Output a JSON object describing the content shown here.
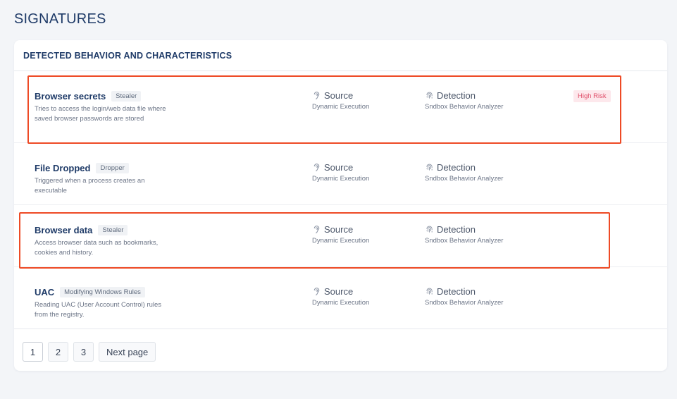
{
  "page": {
    "title": "SIGNATURES"
  },
  "card": {
    "header": "DETECTED BEHAVIOR AND CHARACTERISTICS"
  },
  "rows": [
    {
      "title": "Browser secrets",
      "tag": "Stealer",
      "description": "Tries to access the login/web data file where saved browser passwords are stored",
      "source_label": "Source",
      "source_value": "Dynamic Execution",
      "detection_label": "Detection",
      "detection_value": "Sndbox Behavior Analyzer",
      "risk": "High Risk"
    },
    {
      "title": "File Dropped",
      "tag": "Dropper",
      "description": "Triggered when a process creates an executable",
      "source_label": "Source",
      "source_value": "Dynamic Execution",
      "detection_label": "Detection",
      "detection_value": "Sndbox Behavior Analyzer"
    },
    {
      "title": "Browser data",
      "tag": "Stealer",
      "description": "Access browser data such as bookmarks, cookies and history.",
      "source_label": "Source",
      "source_value": "Dynamic Execution",
      "detection_label": "Detection",
      "detection_value": "Sndbox Behavior Analyzer"
    },
    {
      "title": "UAC",
      "tag": "Modifying Windows Rules",
      "description": "Reading UAC (User Account Control) rules from the registry.",
      "source_label": "Source",
      "source_value": "Dynamic Execution",
      "detection_label": "Detection",
      "detection_value": "Sndbox Behavior Analyzer"
    }
  ],
  "pagination": {
    "pages": [
      "1",
      "2",
      "3"
    ],
    "current": "1",
    "next_label": "Next page"
  },
  "icons": {
    "source": "ear-icon",
    "detection": "fingerprint-icon"
  },
  "colors": {
    "highlight": "#ee4a25",
    "risk_text": "#e0506b",
    "risk_bg": "#fde8ec",
    "title": "#1f3b68"
  }
}
